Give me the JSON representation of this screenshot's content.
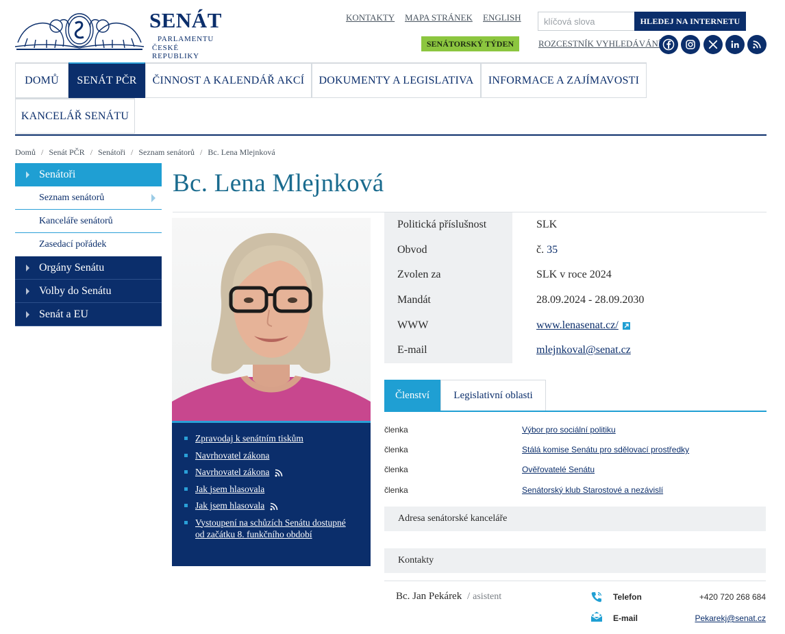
{
  "header": {
    "logo_title": "SENÁT",
    "logo_sub1": "PARLAMENTU",
    "logo_sub2": "ČESKÉ REPUBLIKY",
    "links": {
      "kontakty": "KONTAKTY",
      "mapa": "MAPA STRÁNEK",
      "english": "ENGLISH"
    },
    "search": {
      "placeholder": "klíčová slova",
      "button": "HLEDEJ NA INTERNETU"
    },
    "senatorsky_tyden": "SENÁTORSKÝ TÝDEN",
    "rozcestnik": "ROZCESTNÍK VYHLEDÁVÁNÍ",
    "social_icons": [
      "facebook-icon",
      "instagram-icon",
      "x-icon",
      "linkedin-icon",
      "rss-icon"
    ]
  },
  "nav": {
    "items": [
      {
        "label": "DOMŮ"
      },
      {
        "label": "SENÁT PČR",
        "active": true
      },
      {
        "label": "ČINNOST A KALENDÁŘ AKCÍ"
      },
      {
        "label": "DOKUMENTY A LEGISLATIVA"
      },
      {
        "label": "INFORMACE A ZAJÍMAVOSTI"
      },
      {
        "label": "KANCELÁŘ SENÁTU"
      }
    ]
  },
  "breadcrumb": [
    "Domů",
    "Senát PČR",
    "Senátoři",
    "Seznam senátorů",
    "Bc. Lena Mlejnková"
  ],
  "sidebar": {
    "active": "Senátoři",
    "sub": [
      "Seznam senátorů",
      "Kanceláře senátorů",
      "Zasedací pořádek"
    ],
    "others": [
      "Orgány Senátu",
      "Volby do Senátu",
      "Senát a EU"
    ]
  },
  "senator": {
    "name": "Bc. Lena Mlejnková",
    "info": {
      "party_label": "Politická příslušnost",
      "party": "SLK",
      "obvod_label": "Obvod",
      "obvod_prefix": "č.",
      "obvod_num": "35",
      "zvolen_label": "Zvolen za",
      "zvolen": "SLK v roce 2024",
      "mandat_label": "Mandát",
      "mandat": "28.09.2024 - 28.09.2030",
      "www_label": "WWW",
      "www": "www.lenasenat.cz/",
      "email_label": "E-mail",
      "email": "mlejnkoval@senat.cz"
    },
    "links": [
      "Zpravodaj k senátním tiskům",
      "Navrhovatel zákona",
      "Navrhovatel zákona",
      "Jak jsem hlasovala",
      "Jak jsem hlasovala",
      "Vystoupení na schůzích Senátu dostupné od začátku 8. funkčního období"
    ]
  },
  "tabs": [
    "Členství",
    "Legislativní oblasti"
  ],
  "membership": [
    {
      "role": "členka",
      "org": "Výbor pro sociální politiku"
    },
    {
      "role": "členka",
      "org": "Stálá komise Senátu pro sdělovací prostředky"
    },
    {
      "role": "členka",
      "org": "Ověřovatelé Senátu"
    },
    {
      "role": "členka",
      "org": "Senátorský klub Starostové a nezávislí"
    }
  ],
  "address_title": "Adresa senátorské kanceláře",
  "contacts": {
    "title": "Kontakty",
    "name": "Bc. Jan Pekárek",
    "sep": "/",
    "role": "asistent",
    "phone_label": "Telefon",
    "phone": "+420 720 268 684",
    "email_label": "E-mail",
    "email": "Pekarekj@senat.cz"
  },
  "colors": {
    "navy": "#0b2e6b",
    "accent_blue": "#1f9fd3",
    "title_blue": "#1a6b8e",
    "green_button": "#8cc63f"
  }
}
